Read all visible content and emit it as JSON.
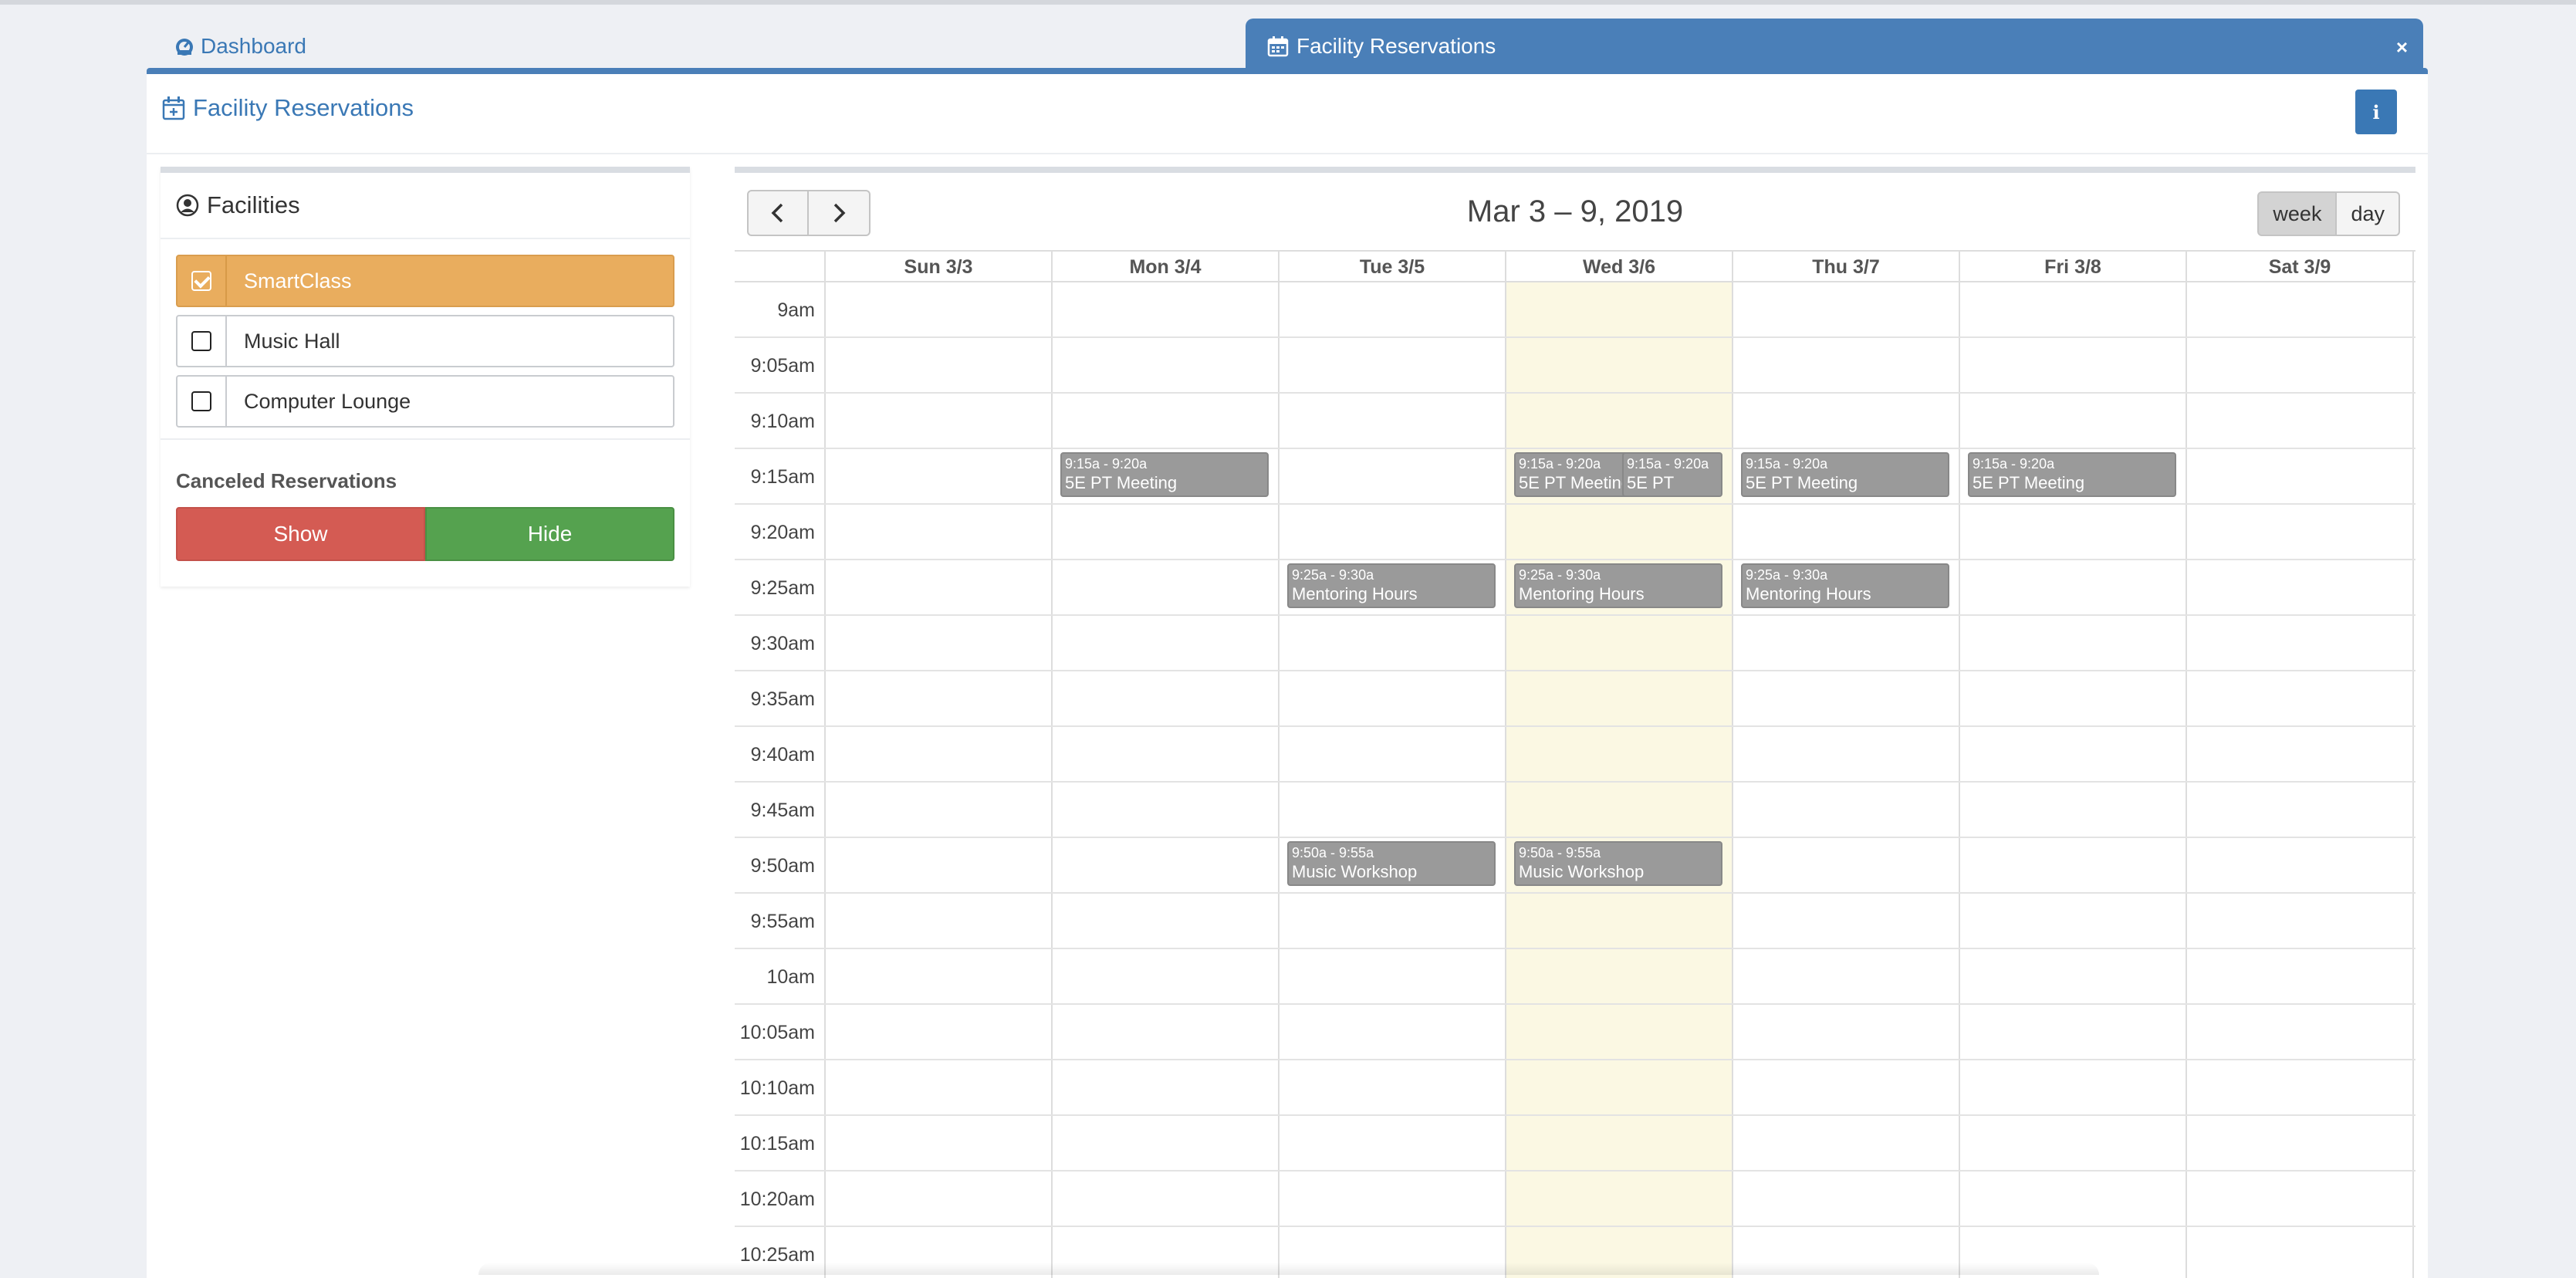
{
  "tabs": {
    "dashboard": {
      "label": "Dashboard"
    },
    "active": {
      "label": "Facility Reservations",
      "close": "×"
    }
  },
  "panel": {
    "title": "Facility Reservations",
    "info_label": "i"
  },
  "sidebar": {
    "title": "Facilities",
    "facilities": [
      {
        "label": "SmartClass",
        "checked": true
      },
      {
        "label": "Music Hall",
        "checked": false
      },
      {
        "label": "Computer Lounge",
        "checked": false
      }
    ],
    "canceled": {
      "title": "Canceled Reservations",
      "show_label": "Show",
      "hide_label": "Hide"
    }
  },
  "colors": {
    "brand_blue": "#4a7fb8",
    "selected_facility": "#e9ad5e",
    "show_red": "#d45b53",
    "hide_green": "#55a24f",
    "event_gray": "#9a9a9a",
    "today_highlight": "#fbf8e3"
  },
  "calendar": {
    "title": "Mar 3 – 9, 2019",
    "views": {
      "week": "week",
      "day": "day"
    },
    "active_view": "week",
    "today_column": "Wed 3/6",
    "days": [
      "Sun 3/3",
      "Mon 3/4",
      "Tue 3/5",
      "Wed 3/6",
      "Thu 3/7",
      "Fri 3/8",
      "Sat 3/9"
    ],
    "times": [
      "9am",
      "9:05am",
      "9:10am",
      "9:15am",
      "9:20am",
      "9:25am",
      "9:30am",
      "9:35am",
      "9:40am",
      "9:45am",
      "9:50am",
      "9:55am",
      "10am",
      "10:05am",
      "10:10am",
      "10:15am",
      "10:20am",
      "10:25am"
    ],
    "events": [
      {
        "day": 1,
        "slot": 3,
        "time": "9:15a - 9:20a",
        "title": "5E PT Meeting"
      },
      {
        "day": 3,
        "slot": 3,
        "time": "9:15a - 9:20a",
        "title": "5E PT Meeting",
        "part": "left"
      },
      {
        "day": 3,
        "slot": 3,
        "time": "9:15a - 9:20a",
        "title": "5E PT",
        "part": "right"
      },
      {
        "day": 4,
        "slot": 3,
        "time": "9:15a - 9:20a",
        "title": "5E PT Meeting"
      },
      {
        "day": 5,
        "slot": 3,
        "time": "9:15a - 9:20a",
        "title": "5E PT Meeting"
      },
      {
        "day": 2,
        "slot": 5,
        "time": "9:25a - 9:30a",
        "title": "Mentoring Hours"
      },
      {
        "day": 3,
        "slot": 5,
        "time": "9:25a - 9:30a",
        "title": "Mentoring Hours"
      },
      {
        "day": 4,
        "slot": 5,
        "time": "9:25a - 9:30a",
        "title": "Mentoring Hours"
      },
      {
        "day": 2,
        "slot": 10,
        "time": "9:50a - 9:55a",
        "title": "Music Workshop"
      },
      {
        "day": 3,
        "slot": 10,
        "time": "9:50a - 9:55a",
        "title": "Music Workshop"
      }
    ]
  }
}
